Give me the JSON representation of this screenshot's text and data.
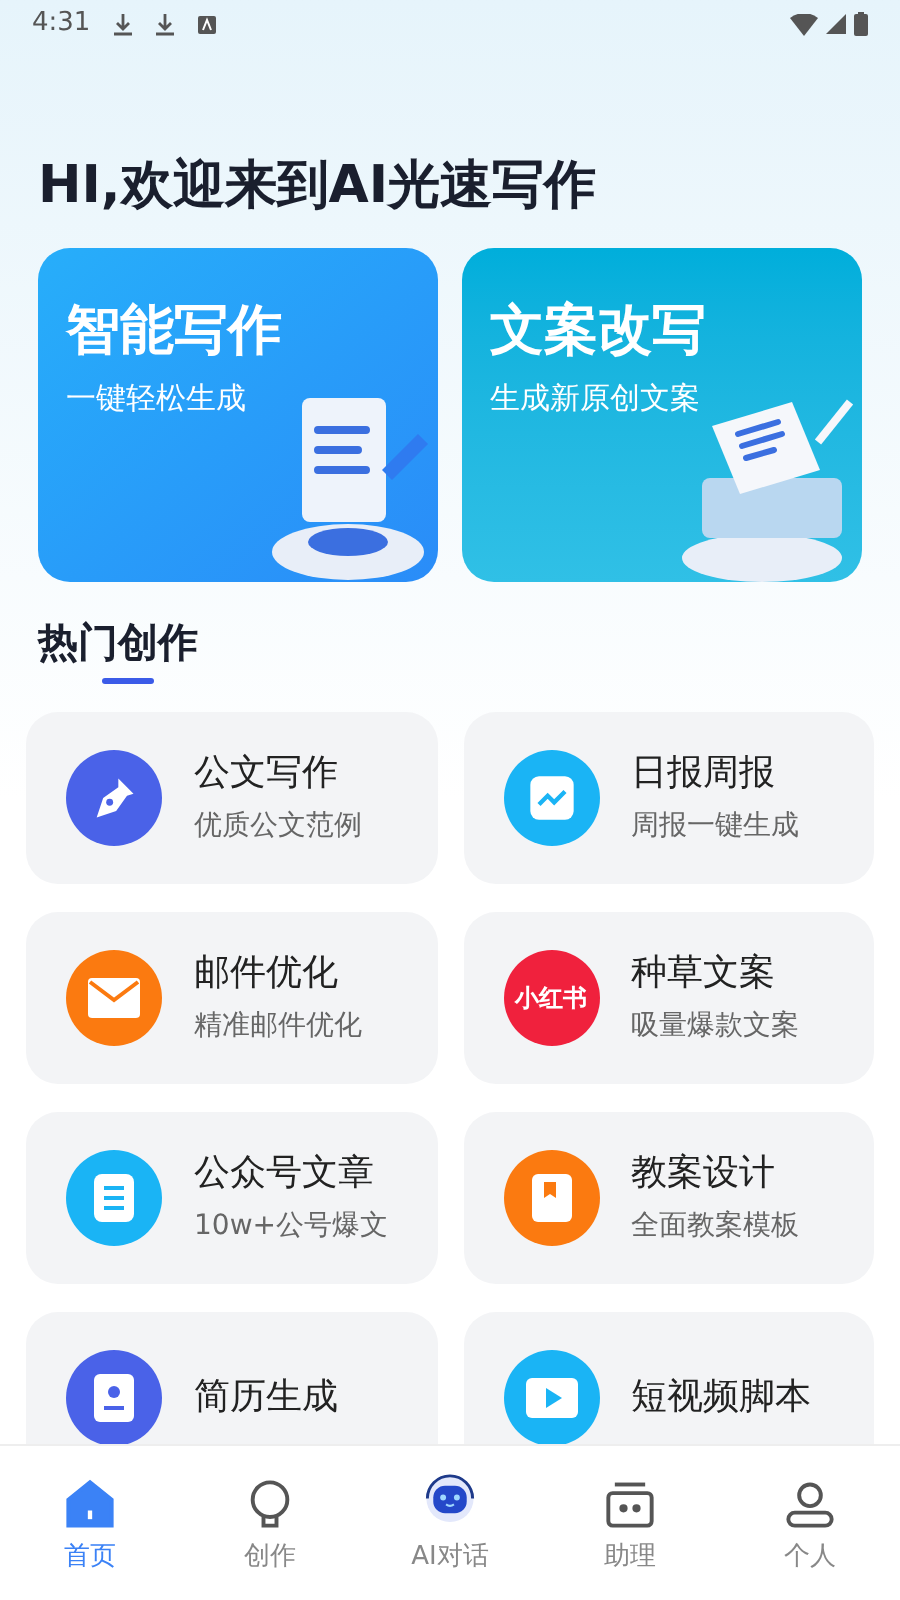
{
  "status_bar": {
    "time": "4:31"
  },
  "greeting": "HI,欢迎来到AI光速写作",
  "banners": [
    {
      "title": "智能写作",
      "subtitle": "一键轻松生成",
      "kind": "scroll"
    },
    {
      "title": "文案改写",
      "subtitle": "生成新原创文案",
      "kind": "paper"
    }
  ],
  "section": {
    "title": "热门创作",
    "selected": true
  },
  "tools": [
    {
      "title": "公文写作",
      "subtitle": "优质公文范例",
      "kind": "pen",
      "color": "#4a62e8"
    },
    {
      "title": "日报周报",
      "subtitle": "周报一键生成",
      "kind": "chart",
      "color": "#1ab4f5"
    },
    {
      "title": "邮件优化",
      "subtitle": "精准邮件优化",
      "kind": "mail",
      "color": "#fb7a10"
    },
    {
      "title": "种草文案",
      "subtitle": "吸量爆款文案",
      "kind": "logo",
      "icon_text": "小红书",
      "color": "#f0213d"
    },
    {
      "title": "公众号文章",
      "subtitle": "10w+公号爆文",
      "kind": "doc",
      "color": "#1ab4f5"
    },
    {
      "title": "教案设计",
      "subtitle": "全面教案模板",
      "kind": "book",
      "color": "#fb7a10"
    },
    {
      "title": "简历生成",
      "kind": "user",
      "color": "#4a62e8"
    },
    {
      "title": "短视频脚本",
      "kind": "video",
      "color": "#1ab4f5"
    }
  ],
  "nav": [
    {
      "label": "首页",
      "kind": "home",
      "selected": true
    },
    {
      "label": "创作",
      "kind": "bulb",
      "selected": false
    },
    {
      "label": "AI对话",
      "kind": "robot",
      "selected": false
    },
    {
      "label": "助理",
      "kind": "box",
      "selected": false
    },
    {
      "label": "个人",
      "kind": "person",
      "selected": false
    }
  ]
}
